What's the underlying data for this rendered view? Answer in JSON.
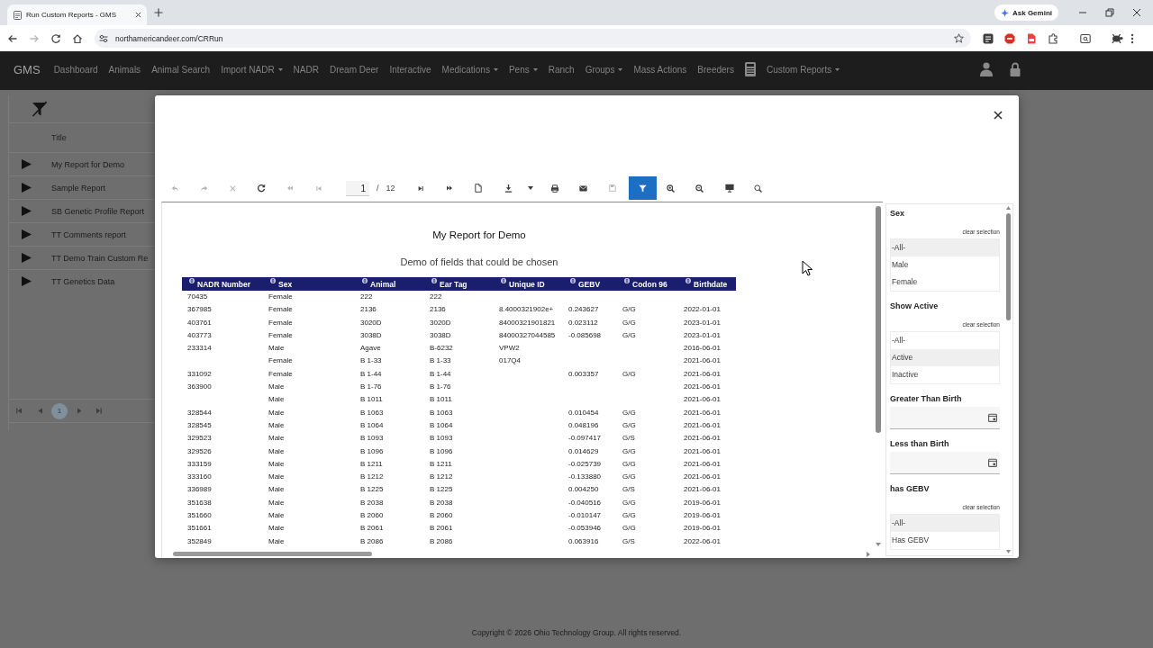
{
  "browser": {
    "tabs": [
      {
        "title": "Run Custom Reports - GMS",
        "selected": true
      }
    ],
    "ask_button": "Ask Gemini",
    "back": {
      "disabled": false
    },
    "forward": {
      "disabled": true
    },
    "address": "northamericandeer.com/CRRun"
  },
  "navbar": {
    "brand": "GMS",
    "items": [
      {
        "kind": "link",
        "label": "Dashboard",
        "dropdown": false
      },
      {
        "kind": "link",
        "label": "Animals",
        "dropdown": false
      },
      {
        "kind": "link",
        "label": "Animal Search",
        "dropdown": false
      },
      {
        "kind": "link",
        "label": "Import NADR",
        "dropdown": true
      },
      {
        "kind": "link",
        "label": "NADR",
        "dropdown": false
      },
      {
        "kind": "link",
        "label": "Dream Deer",
        "dropdown": false
      },
      {
        "kind": "link",
        "label": "Interactive",
        "dropdown": false
      },
      {
        "kind": "link",
        "label": "Medications",
        "dropdown": true
      },
      {
        "kind": "link",
        "label": "Pens",
        "dropdown": true
      },
      {
        "kind": "link",
        "label": "Ranch",
        "dropdown": false
      },
      {
        "kind": "link",
        "label": "Groups",
        "dropdown": true
      },
      {
        "kind": "link",
        "label": "Mass Actions",
        "dropdown": false
      },
      {
        "kind": "link",
        "label": "Breeders",
        "dropdown": false
      },
      {
        "kind": "icon"
      },
      {
        "kind": "link",
        "label": "Custom Reports",
        "dropdown": true
      }
    ]
  },
  "sidebar": {
    "header": "Title",
    "items": [
      "My Report for Demo",
      "Sample Report",
      "SB Genetic Profile Report",
      "TT Comments report",
      "TT Demo Train Custom Re",
      "TT Genetics Data"
    ],
    "pager": [
      {
        "label": "1",
        "selected": true
      }
    ]
  },
  "modal": {
    "toolbar": {
      "undo": {
        "disabled": true
      },
      "redo": {
        "disabled": true
      },
      "cancel": {
        "disabled": true
      },
      "refresh": {
        "disabled": false
      },
      "first_page": {
        "disabled": true
      },
      "previous_page": {
        "disabled": true
      },
      "page": {
        "value": "1"
      },
      "page_separator": "/",
      "page_count": "12",
      "next_page": {
        "disabled": false
      },
      "last_page": {
        "disabled": false
      },
      "save": {
        "disabled": true
      },
      "filter": {
        "selected": true
      }
    },
    "report": {
      "title": "My Report for Demo",
      "subtitle": "Demo of fields that could be chosen",
      "columns": [
        "NADR Number",
        "Sex",
        "Animal",
        "Ear Tag",
        "Unique ID",
        "GEBV",
        "Codon 96",
        "Birthdate"
      ],
      "rows": [
        [
          "70435",
          "Female",
          "222",
          "222",
          null,
          null,
          null,
          null
        ],
        [
          "367985",
          "Female",
          "2136",
          "2136",
          "8.4000321902e+",
          "0.243627",
          "G/G",
          "2022-01-01"
        ],
        [
          "403761",
          "Female",
          "3020D",
          "3020D",
          "84000321901821",
          "0.023112",
          "G/G",
          "2023-01-01"
        ],
        [
          "403773",
          "Female",
          "3038D",
          "3038D",
          "84000327044585",
          "-0.085698",
          "G/G",
          "2023-01-01"
        ],
        [
          "233314",
          "Male",
          "Agave",
          "B-6232",
          "VPW2",
          null,
          null,
          "2016-06-01"
        ],
        [
          null,
          "Female",
          "B 1-33",
          "B 1-33",
          "017Q4",
          null,
          null,
          "2021-06-01"
        ],
        [
          "331092",
          "Female",
          "B 1-44",
          "B 1-44",
          null,
          "0.003357",
          "G/G",
          "2021-06-01"
        ],
        [
          "363900",
          "Male",
          "B 1-76",
          "B 1-76",
          null,
          null,
          null,
          "2021-06-01"
        ],
        [
          null,
          "Male",
          "B 1011",
          "B 1011",
          null,
          null,
          null,
          "2021-06-01"
        ],
        [
          "328544",
          "Male",
          "B 1063",
          "B 1063",
          null,
          "0.010454",
          "G/G",
          "2021-06-01"
        ],
        [
          "328545",
          "Male",
          "B 1064",
          "B 1064",
          null,
          "0.048196",
          "G/G",
          "2021-06-01"
        ],
        [
          "329523",
          "Male",
          "B 1093",
          "B 1093",
          null,
          "-0.097417",
          "G/S",
          "2021-06-01"
        ],
        [
          "329526",
          "Male",
          "B 1096",
          "B 1096",
          null,
          "0.014629",
          "G/G",
          "2021-06-01"
        ],
        [
          "333159",
          "Male",
          "B 1211",
          "B 1211",
          null,
          "-0.025739",
          "G/G",
          "2021-06-01"
        ],
        [
          "333160",
          "Male",
          "B 1212",
          "B 1212",
          null,
          "-0.133880",
          "G/G",
          "2021-06-01"
        ],
        [
          "336989",
          "Male",
          "B 1225",
          "B 1225",
          null,
          "0.004250",
          "G/S",
          "2021-06-01"
        ],
        [
          "351638",
          "Male",
          "B 2038",
          "B 2038",
          null,
          "-0.040516",
          "G/G",
          "2019-06-01"
        ],
        [
          "351660",
          "Male",
          "B 2060",
          "B 2060",
          null,
          "-0.010147",
          "G/G",
          "2019-06-01"
        ],
        [
          "351661",
          "Male",
          "B 2061",
          "B 2061",
          null,
          "-0.053946",
          "G/G",
          "2019-06-01"
        ],
        [
          "352849",
          "Male",
          "B 2086",
          "B 2086",
          null,
          "0.063916",
          "G/S",
          "2022-06-01"
        ]
      ]
    },
    "filters": [
      {
        "kind": "list",
        "title": "Sex",
        "clear": "clear selection",
        "options": [
          {
            "label": "-All-",
            "selected": true
          },
          {
            "label": "Male",
            "selected": false
          },
          {
            "label": "Female",
            "selected": false
          }
        ]
      },
      {
        "kind": "list",
        "title": "Show Active",
        "clear": "clear selection",
        "options": [
          {
            "label": "-All-",
            "selected": false
          },
          {
            "label": "Active",
            "selected": true
          },
          {
            "label": "Inactive",
            "selected": false
          }
        ]
      },
      {
        "kind": "date",
        "title": "Greater Than Birth"
      },
      {
        "kind": "date",
        "title": "Less than Birth"
      },
      {
        "kind": "list",
        "title": "has GEBV",
        "clear": "clear selection",
        "options": [
          {
            "label": "-All-",
            "selected": true
          },
          {
            "label": "Has GEBV",
            "selected": false
          }
        ]
      }
    ]
  },
  "footer": "Copyright © 2026 Ohio Technology Group. All rights reserved."
}
